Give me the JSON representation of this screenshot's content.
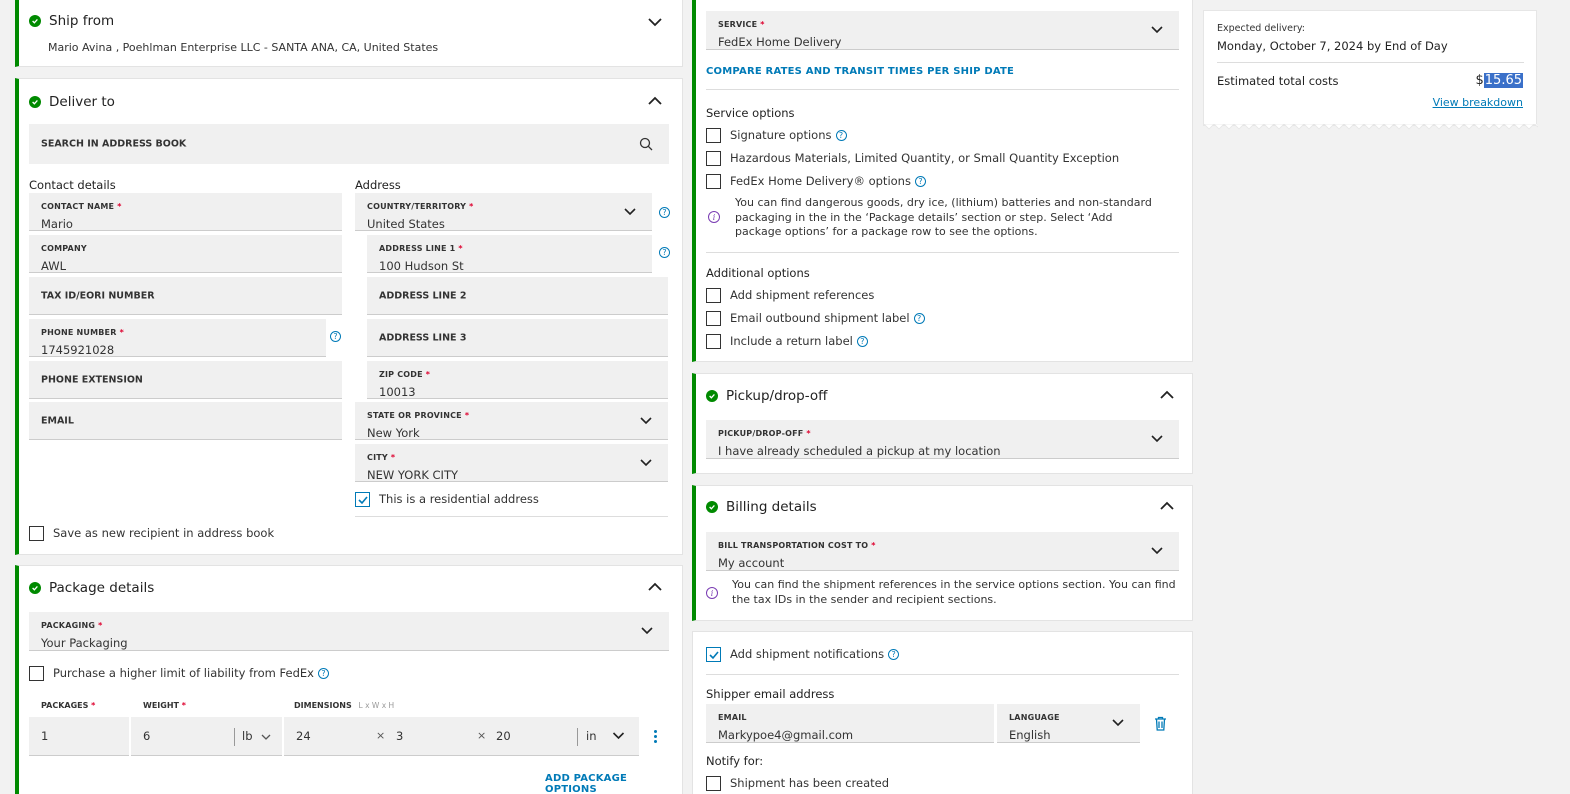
{
  "ship_from": {
    "title": "Ship from",
    "address": "Mario Avina , Poehlman Enterprise LLC - SANTA ANA, CA, United States"
  },
  "deliver_to": {
    "title": "Deliver to",
    "search_placeholder": "SEARCH IN ADDRESS BOOK",
    "contact_heading": "Contact details",
    "address_heading": "Address",
    "contact_name_label": "CONTACT NAME",
    "contact_name_value": "Mario",
    "company_label": "COMPANY",
    "company_value": "AWL",
    "tax_id_label": "TAX ID/EORI NUMBER",
    "phone_label": "PHONE NUMBER",
    "phone_value": "1745921028",
    "phone_ext_label": "PHONE EXTENSION",
    "email_label": "EMAIL",
    "country_label": "COUNTRY/TERRITORY",
    "country_value": "United States",
    "addr1_label": "ADDRESS LINE 1",
    "addr1_value": "100 Hudson St",
    "addr2_label": "ADDRESS LINE 2",
    "addr3_label": "ADDRESS LINE 3",
    "zip_label": "ZIP CODE",
    "zip_value": "10013",
    "state_label": "STATE OR PROVINCE",
    "state_value": "New York",
    "city_label": "CITY",
    "city_value": "NEW YORK CITY",
    "residential_label": "This is a residential address",
    "save_recipient_label": "Save as new recipient in address book"
  },
  "package": {
    "title": "Package details",
    "packaging_label": "PACKAGING",
    "packaging_value": "Your Packaging",
    "liability_label": "Purchase a higher limit of liability from FedEx",
    "packages_label": "PACKAGES",
    "weight_label": "WEIGHT",
    "dimensions_label": "DIMENSIONS",
    "dimensions_hint": "L x W x H",
    "packages_value": "1",
    "weight_value": "6",
    "weight_unit": "lb",
    "dim_l": "24",
    "dim_w": "3",
    "dim_h": "20",
    "dim_unit": "in",
    "times": "×",
    "add_options_link": "ADD PACKAGE OPTIONS"
  },
  "service": {
    "service_label": "SERVICE",
    "service_value": "FedEx Home Delivery",
    "compare_link": "COMPARE RATES AND TRANSIT TIMES PER SHIP DATE",
    "options_heading": "Service options",
    "signature": "Signature options",
    "hazmat": "Hazardous Materials, Limited Quantity, or Small Quantity Exception",
    "home_delivery_options": "FedEx Home Delivery® options",
    "info_text": "You can find dangerous goods, dry ice, (lithium) batteries and non-standard packaging in the in the ‘Package details’ section or step. Select ‘Add package options’ for a package row to see the options.",
    "additional_heading": "Additional options",
    "add_references": "Add shipment references",
    "email_label_opt": "Email outbound shipment label",
    "return_label": "Include a return label"
  },
  "pickup": {
    "title": "Pickup/drop-off",
    "field_label": "PICKUP/DROP-OFF",
    "field_value": "I have already scheduled a pickup at my location"
  },
  "billing": {
    "title": "Billing details",
    "field_label": "BILL TRANSPORTATION COST TO",
    "field_value": "My account",
    "info_text": "You can find the shipment references in the service options section. You can find the tax IDs in the sender and recipient sections."
  },
  "notifications": {
    "add_label": "Add shipment notifications",
    "shipper_heading": "Shipper email address",
    "email_label": "EMAIL",
    "email_value": "Markypoe4@gmail.com",
    "language_label": "LANGUAGE",
    "language_value": "English",
    "notify_heading": "Notify for:",
    "created_label": "Shipment has been created"
  },
  "summary": {
    "expected_label": "Expected delivery:",
    "expected_value": "Monday, October 7, 2024 by End of Day",
    "total_label": "Estimated total costs",
    "currency": "$",
    "total_value": "15.65",
    "breakdown_link": "View breakdown"
  },
  "colors": {
    "accent_green": "#008a00",
    "link_blue": "#007ab7",
    "required_red": "#de002e",
    "info_purple": "#7a3cb3"
  }
}
